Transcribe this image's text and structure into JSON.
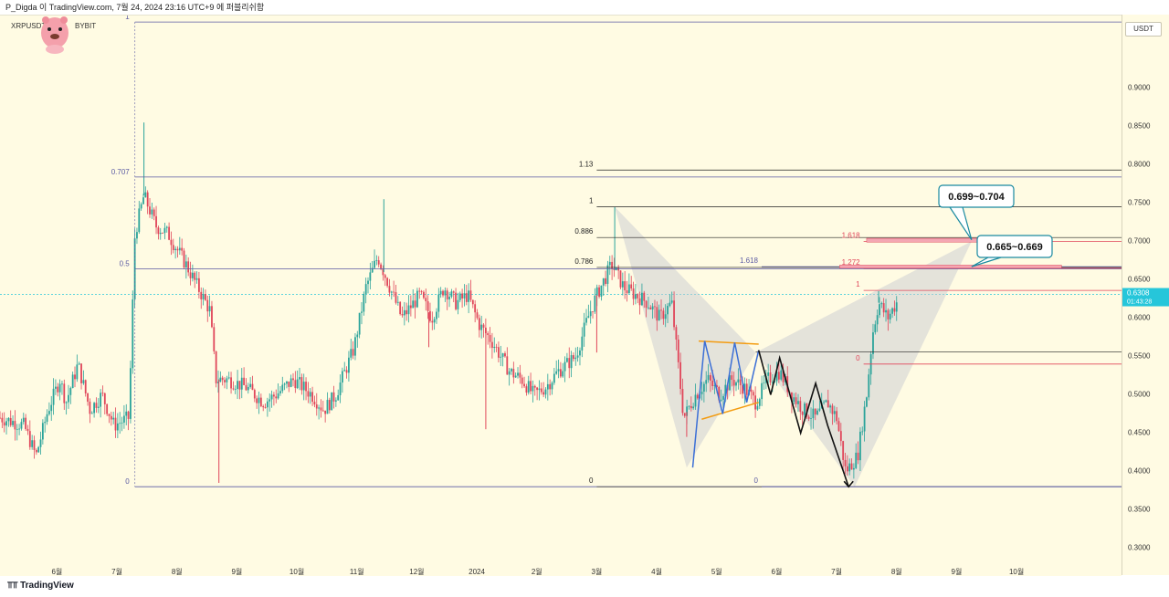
{
  "header": {
    "title": "P_Digda 이 TradingView.com, 7월 24, 2024 23:16 UTC+9 에 퍼블리쉬함"
  },
  "symbol": {
    "pair": "XRPUSDT",
    "exchange": "BYBIT"
  },
  "currency_button": "USDT",
  "footer": {
    "brand": "TradingView"
  },
  "colors": {
    "background": "#fffbe3",
    "candle_up": "#2aa39a",
    "candle_down": "#e0465a",
    "fib_line": "#5b5ba3",
    "pattern_fill": "#c9ccd1",
    "price_tag": "#26c6da",
    "target_zone": "#f4a7b3"
  },
  "current_price": {
    "value": "0.6308",
    "countdown": "01:43:28"
  },
  "chart_data": {
    "type": "candlestick",
    "title": "",
    "xlabel": "",
    "ylabel": "",
    "ylim": [
      0.285,
      0.985
    ],
    "y_ticks": [
      "0.9000",
      "0.8500",
      "0.8000",
      "0.7500",
      "0.7000",
      "0.6500",
      "0.6000",
      "0.5500",
      "0.5000",
      "0.4500",
      "0.4000",
      "0.3500",
      "0.3000"
    ],
    "y_tick_values": [
      0.9,
      0.85,
      0.8,
      0.75,
      0.7,
      0.65,
      0.6,
      0.55,
      0.5,
      0.45,
      0.4,
      0.35,
      0.3
    ],
    "x_ticks": [
      "6월",
      "7월",
      "8월",
      "9월",
      "10월",
      "11월",
      "12월",
      "2024",
      "2월",
      "3월",
      "4월",
      "5월",
      "6월",
      "7월",
      "8월",
      "9월",
      "10월"
    ],
    "x_tick_values": [
      0.85,
      1.85,
      2.85,
      3.85,
      4.85,
      5.85,
      6.85,
      7.85,
      8.85,
      9.85,
      10.85,
      11.85,
      12.85,
      13.85,
      14.85,
      15.85,
      16.85
    ],
    "x_range": [
      -0.1,
      18.6
    ],
    "price_path": [
      [
        -0.1,
        0.47
      ],
      [
        0.3,
        0.46
      ],
      [
        0.5,
        0.42
      ],
      [
        0.7,
        0.48
      ],
      [
        0.9,
        0.52
      ],
      [
        1.0,
        0.49
      ],
      [
        1.2,
        0.54
      ],
      [
        1.4,
        0.48
      ],
      [
        1.6,
        0.5
      ],
      [
        1.8,
        0.46
      ],
      [
        2.05,
        0.47
      ],
      [
        2.15,
        0.71
      ],
      [
        2.3,
        0.76
      ],
      [
        2.5,
        0.72
      ],
      [
        2.7,
        0.71
      ],
      [
        3.0,
        0.67
      ],
      [
        3.2,
        0.64
      ],
      [
        3.4,
        0.61
      ],
      [
        3.5,
        0.52
      ],
      [
        3.7,
        0.52
      ],
      [
        4.0,
        0.51
      ],
      [
        4.3,
        0.49
      ],
      [
        4.5,
        0.5
      ],
      [
        4.8,
        0.52
      ],
      [
        5.1,
        0.5
      ],
      [
        5.3,
        0.48
      ],
      [
        5.5,
        0.5
      ],
      [
        5.8,
        0.56
      ],
      [
        6.0,
        0.64
      ],
      [
        6.2,
        0.68
      ],
      [
        6.4,
        0.64
      ],
      [
        6.6,
        0.6
      ],
      [
        6.9,
        0.63
      ],
      [
        7.1,
        0.6
      ],
      [
        7.3,
        0.64
      ],
      [
        7.5,
        0.62
      ],
      [
        7.7,
        0.63
      ],
      [
        7.9,
        0.59
      ],
      [
        8.1,
        0.57
      ],
      [
        8.4,
        0.53
      ],
      [
        8.6,
        0.52
      ],
      [
        8.8,
        0.5
      ],
      [
        9.0,
        0.51
      ],
      [
        9.2,
        0.53
      ],
      [
        9.5,
        0.55
      ],
      [
        9.7,
        0.6
      ],
      [
        9.85,
        0.63
      ],
      [
        10.1,
        0.67
      ],
      [
        10.3,
        0.64
      ],
      [
        10.5,
        0.63
      ],
      [
        10.7,
        0.62
      ],
      [
        10.9,
        0.6
      ],
      [
        11.1,
        0.62
      ],
      [
        11.3,
        0.47
      ],
      [
        11.5,
        0.5
      ],
      [
        11.7,
        0.52
      ],
      [
        11.9,
        0.5
      ],
      [
        12.1,
        0.52
      ],
      [
        12.3,
        0.51
      ],
      [
        12.5,
        0.49
      ],
      [
        12.7,
        0.52
      ],
      [
        12.9,
        0.53
      ],
      [
        13.1,
        0.5
      ],
      [
        13.3,
        0.48
      ],
      [
        13.5,
        0.47
      ],
      [
        13.7,
        0.49
      ],
      [
        13.85,
        0.47
      ],
      [
        14.0,
        0.4
      ],
      [
        14.2,
        0.42
      ],
      [
        14.35,
        0.5
      ],
      [
        14.45,
        0.58
      ],
      [
        14.55,
        0.62
      ],
      [
        14.7,
        0.6
      ],
      [
        14.85,
        0.62
      ]
    ],
    "spikes": [
      [
        2.3,
        0.855
      ],
      [
        3.55,
        0.385
      ],
      [
        6.3,
        0.755
      ],
      [
        7.05,
        0.562
      ],
      [
        8.0,
        0.455
      ],
      [
        9.85,
        0.555
      ],
      [
        10.15,
        0.745
      ],
      [
        11.35,
        0.445
      ],
      [
        14.1,
        0.405
      ],
      [
        14.55,
        0.635
      ]
    ],
    "fib_retracement_left": {
      "levels": [
        {
          "label": "1",
          "value": 0.986
        },
        {
          "label": "0.707",
          "value": 0.784
        },
        {
          "label": "0.5",
          "value": 0.664
        },
        {
          "label": "0",
          "value": 0.38
        }
      ]
    },
    "fib_retracement_mid": {
      "levels": [
        {
          "label": "1.13",
          "value": 0.793
        },
        {
          "label": "1",
          "value": 0.745
        },
        {
          "label": "0.886",
          "value": 0.705
        },
        {
          "label": "0.786",
          "value": 0.666
        },
        {
          "label": "0",
          "value": 0.38
        }
      ]
    },
    "extension_levels": [
      {
        "label": "1.618",
        "value": 0.667,
        "color": "#5b5ba3"
      },
      {
        "label": "1.618",
        "value": 0.7,
        "color": "#e0465a"
      },
      {
        "label": "1.272",
        "value": 0.665,
        "color": "#e0465a"
      },
      {
        "label": "1",
        "value": 0.636,
        "color": "#e0465a"
      },
      {
        "label": "0",
        "value": 0.54,
        "color": "#e0465a"
      },
      {
        "label": "0",
        "value": 0.38,
        "color": "#5b5ba3"
      }
    ],
    "callouts": [
      {
        "text": "0.699~0.704",
        "value": 0.702
      },
      {
        "text": "0.665~0.669",
        "value": 0.667
      }
    ],
    "reference_line": 0.556
  }
}
